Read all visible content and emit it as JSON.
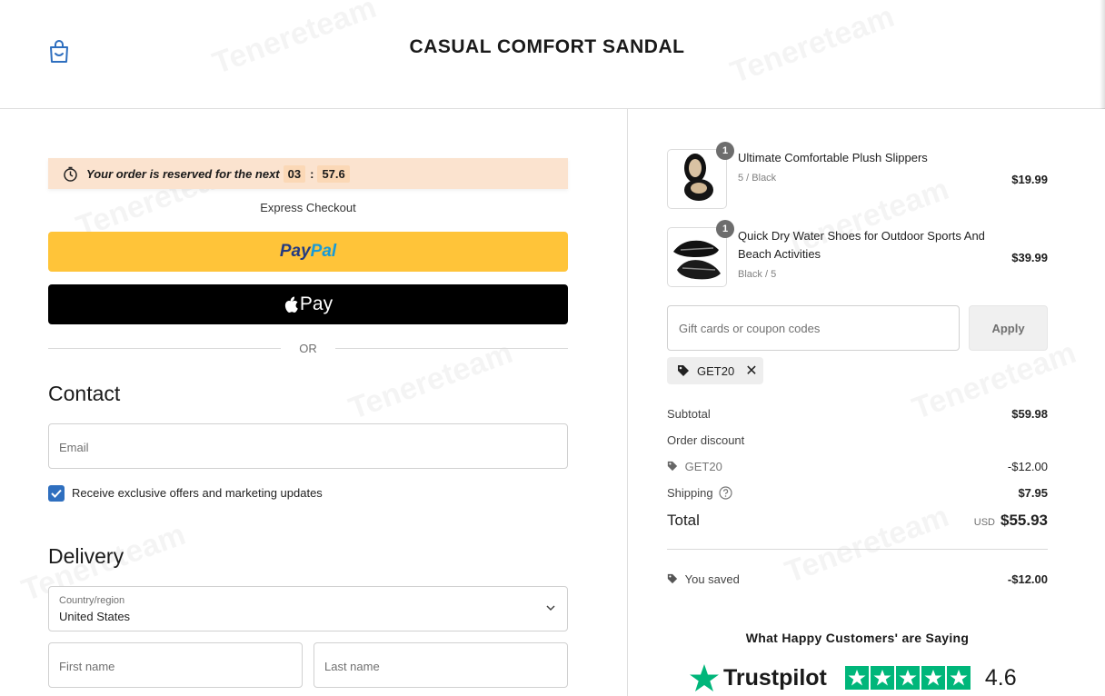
{
  "header": {
    "store_title": "CASUAL COMFORT SANDAL",
    "bag_icon": "shopping-bag-icon"
  },
  "reservation": {
    "text": "Your order is reserved for the next",
    "minutes": "03",
    "seconds": "57.6",
    "separator": ":",
    "icon": "stopwatch-icon"
  },
  "express": {
    "label": "Express Checkout",
    "paypal_part1": "Pay",
    "paypal_part2": "Pal",
    "applepay_label": "Pay",
    "or_label": "OR"
  },
  "contact": {
    "heading": "Contact",
    "email_placeholder": "Email",
    "marketing_label": "Receive exclusive offers and marketing updates",
    "marketing_checked": true
  },
  "delivery": {
    "heading": "Delivery",
    "country_label": "Country/region",
    "country_value": "United States",
    "first_name_placeholder": "First name",
    "last_name_placeholder": "Last name"
  },
  "cart": {
    "items": [
      {
        "name": "Ultimate Comfortable Plush Slippers",
        "variant": "5 / Black",
        "price": "$19.99",
        "qty": "1"
      },
      {
        "name": "Quick Dry Water Shoes for Outdoor Sports And Beach Activities",
        "variant": "Black / 5",
        "price": "$39.99",
        "qty": "1"
      }
    ],
    "coupon_placeholder": "Gift cards or coupon codes",
    "apply_label": "Apply",
    "applied_code": "GET20",
    "remove_symbol": "✕"
  },
  "summary": {
    "subtotal_label": "Subtotal",
    "subtotal_value": "$59.98",
    "order_discount_label": "Order discount",
    "discount_code": "GET20",
    "discount_value": "-$12.00",
    "shipping_label": "Shipping",
    "shipping_value": "$7.95",
    "total_label": "Total",
    "total_currency": "USD",
    "total_value": "$55.93",
    "saved_label": "You saved",
    "saved_value": "-$12.00"
  },
  "reviews": {
    "heading": "What Happy Customers' are Saying",
    "brand": "Trustpilot",
    "rating": "4.6",
    "stars": 5,
    "star_color": "#00b67a"
  },
  "watermark": "Tenereteam",
  "colors": {
    "paypal_yellow": "#ffc439",
    "reserve_bg": "#fbe3cf",
    "checkbox_blue": "#2f6fbf"
  }
}
